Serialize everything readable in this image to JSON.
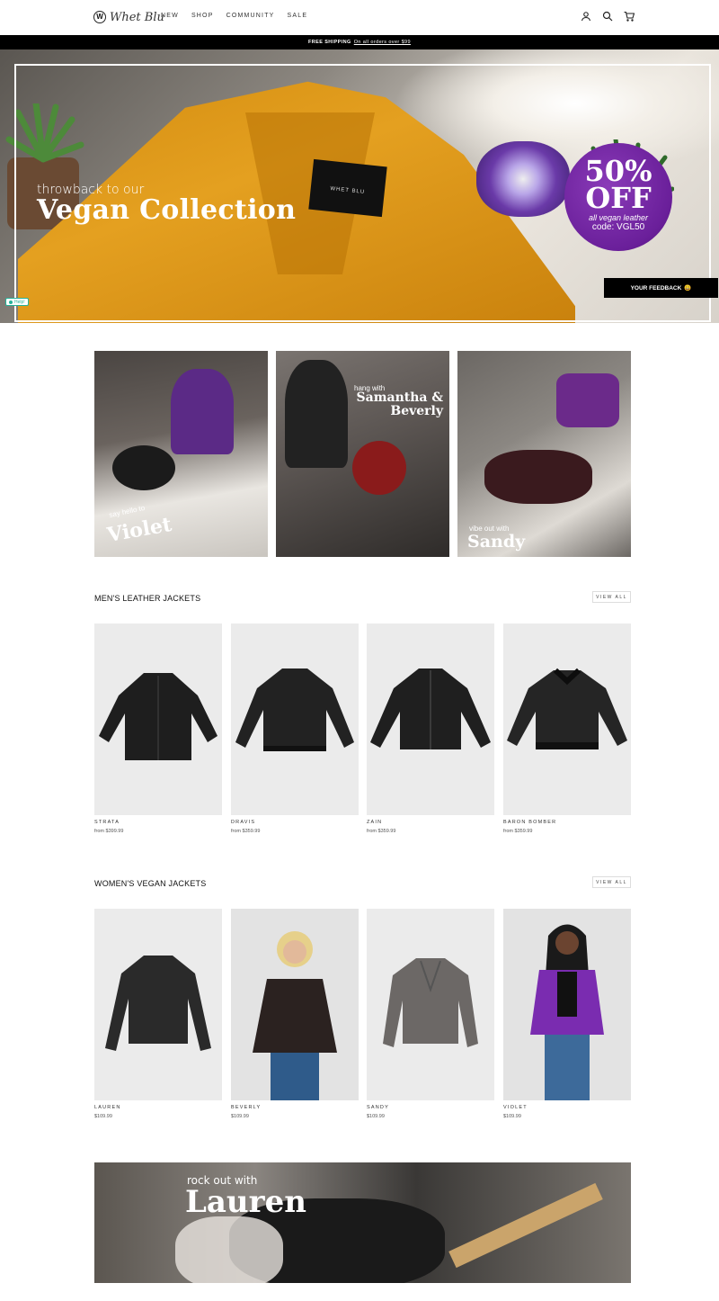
{
  "header": {
    "logo_text": "Whet Blu",
    "logo_mark": "W",
    "nav": [
      "NEW",
      "SHOP",
      "COMMUNITY",
      "SALE"
    ],
    "icons": [
      "account-icon",
      "search-icon",
      "cart-icon"
    ]
  },
  "announcement": {
    "label": "FREE SHIPPING",
    "link": "On all orders over $99"
  },
  "hero": {
    "subtitle": "throwback to our",
    "title": "Vegan Collection",
    "tag_text": "WHET BLU",
    "badge": {
      "percent": "50%",
      "off": "OFF",
      "line": "all vegan leather",
      "code": "code: VGL50"
    },
    "feedback_label": "YOUR FEEDBACK",
    "feedback_emoji": "😀",
    "help_label": "Help!"
  },
  "lifestyle": [
    {
      "small": "say hello to",
      "big": "Violet"
    },
    {
      "small": "hang with",
      "big": "Samantha & Beverly"
    },
    {
      "small": "vibe out with",
      "big": "Sandy"
    }
  ],
  "mens": {
    "title": "MEN'S LEATHER JACKETS",
    "view_all": "VIEW ALL",
    "products": [
      {
        "name": "STRATA",
        "price": "from $399.99"
      },
      {
        "name": "DRAVIS",
        "price": "from $359.99"
      },
      {
        "name": "ZAIN",
        "price": "from $359.99"
      },
      {
        "name": "BARON BOMBER",
        "price": "from $359.99"
      }
    ]
  },
  "womens": {
    "title": "WOMEN'S VEGAN JACKETS",
    "view_all": "VIEW ALL",
    "products": [
      {
        "name": "LAUREN",
        "price": "$109.99"
      },
      {
        "name": "BEVERLY",
        "price": "$109.99"
      },
      {
        "name": "SANDY",
        "price": "$109.99"
      },
      {
        "name": "VIOLET",
        "price": "$109.99"
      }
    ]
  },
  "banner": {
    "subtitle": "rock out with",
    "title": "Lauren"
  },
  "colors": {
    "hero_jacket": "#d99216",
    "badge_purple": "#6a1f9a",
    "announcement_bg": "#000000",
    "product_bg": "#ebebeb"
  }
}
